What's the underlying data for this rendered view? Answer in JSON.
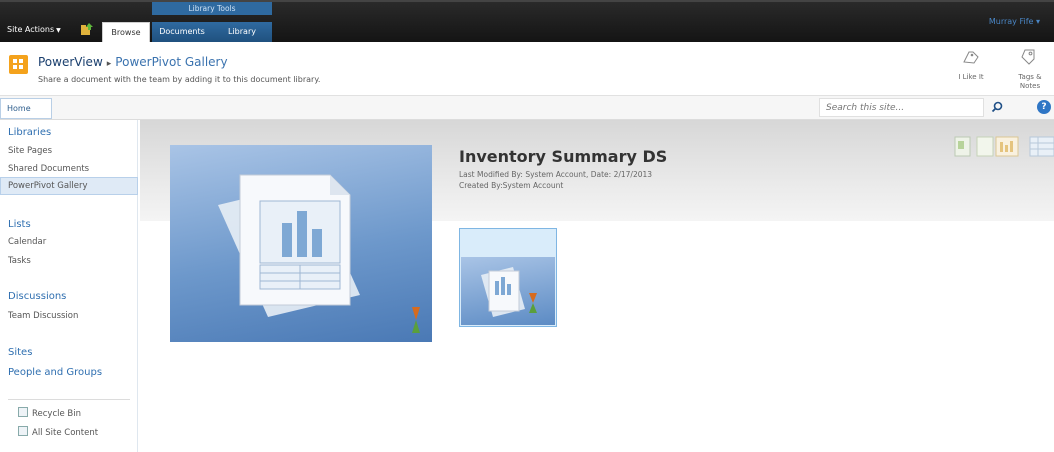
{
  "ribbon": {
    "site_actions": "Site Actions",
    "group_label": "Library Tools",
    "tabs": [
      {
        "label": "Browse",
        "selected": true
      },
      {
        "label": "Documents"
      },
      {
        "label": "Library"
      }
    ],
    "user": "Murray Fife"
  },
  "title_area": {
    "breadcrumb_site": "PowerView",
    "breadcrumb_page": "PowerPivot Gallery",
    "description": "Share a document with the team by adding it to this document library.",
    "like_label": "I Like It",
    "tags_label_1": "Tags &",
    "tags_label_2": "Notes"
  },
  "topnav": {
    "home": "Home",
    "search_placeholder": "Search this site..."
  },
  "leftnav": {
    "libraries": "Libraries",
    "library_items": [
      "Site Pages",
      "Shared Documents",
      "PowerPivot Gallery"
    ],
    "lists": "Lists",
    "list_items": [
      "Calendar",
      "Tasks"
    ],
    "discussions": "Discussions",
    "discussion_items": [
      "Team Discussion"
    ],
    "sites": "Sites",
    "people": "People and Groups",
    "recycle_bin": "Recycle Bin",
    "all_content": "All Site Content"
  },
  "document": {
    "title": "Inventory Summary DS",
    "modified_line": "Last Modified By: System Account,  Date: 2/17/2013",
    "created_line": "Created By:System Account"
  },
  "colors": {
    "ribbon_bg": "#1a1a1a",
    "contextual_tab": "#2f6aa0",
    "link_blue": "#2f6fb0",
    "preview_blue": "#6d98cb"
  }
}
